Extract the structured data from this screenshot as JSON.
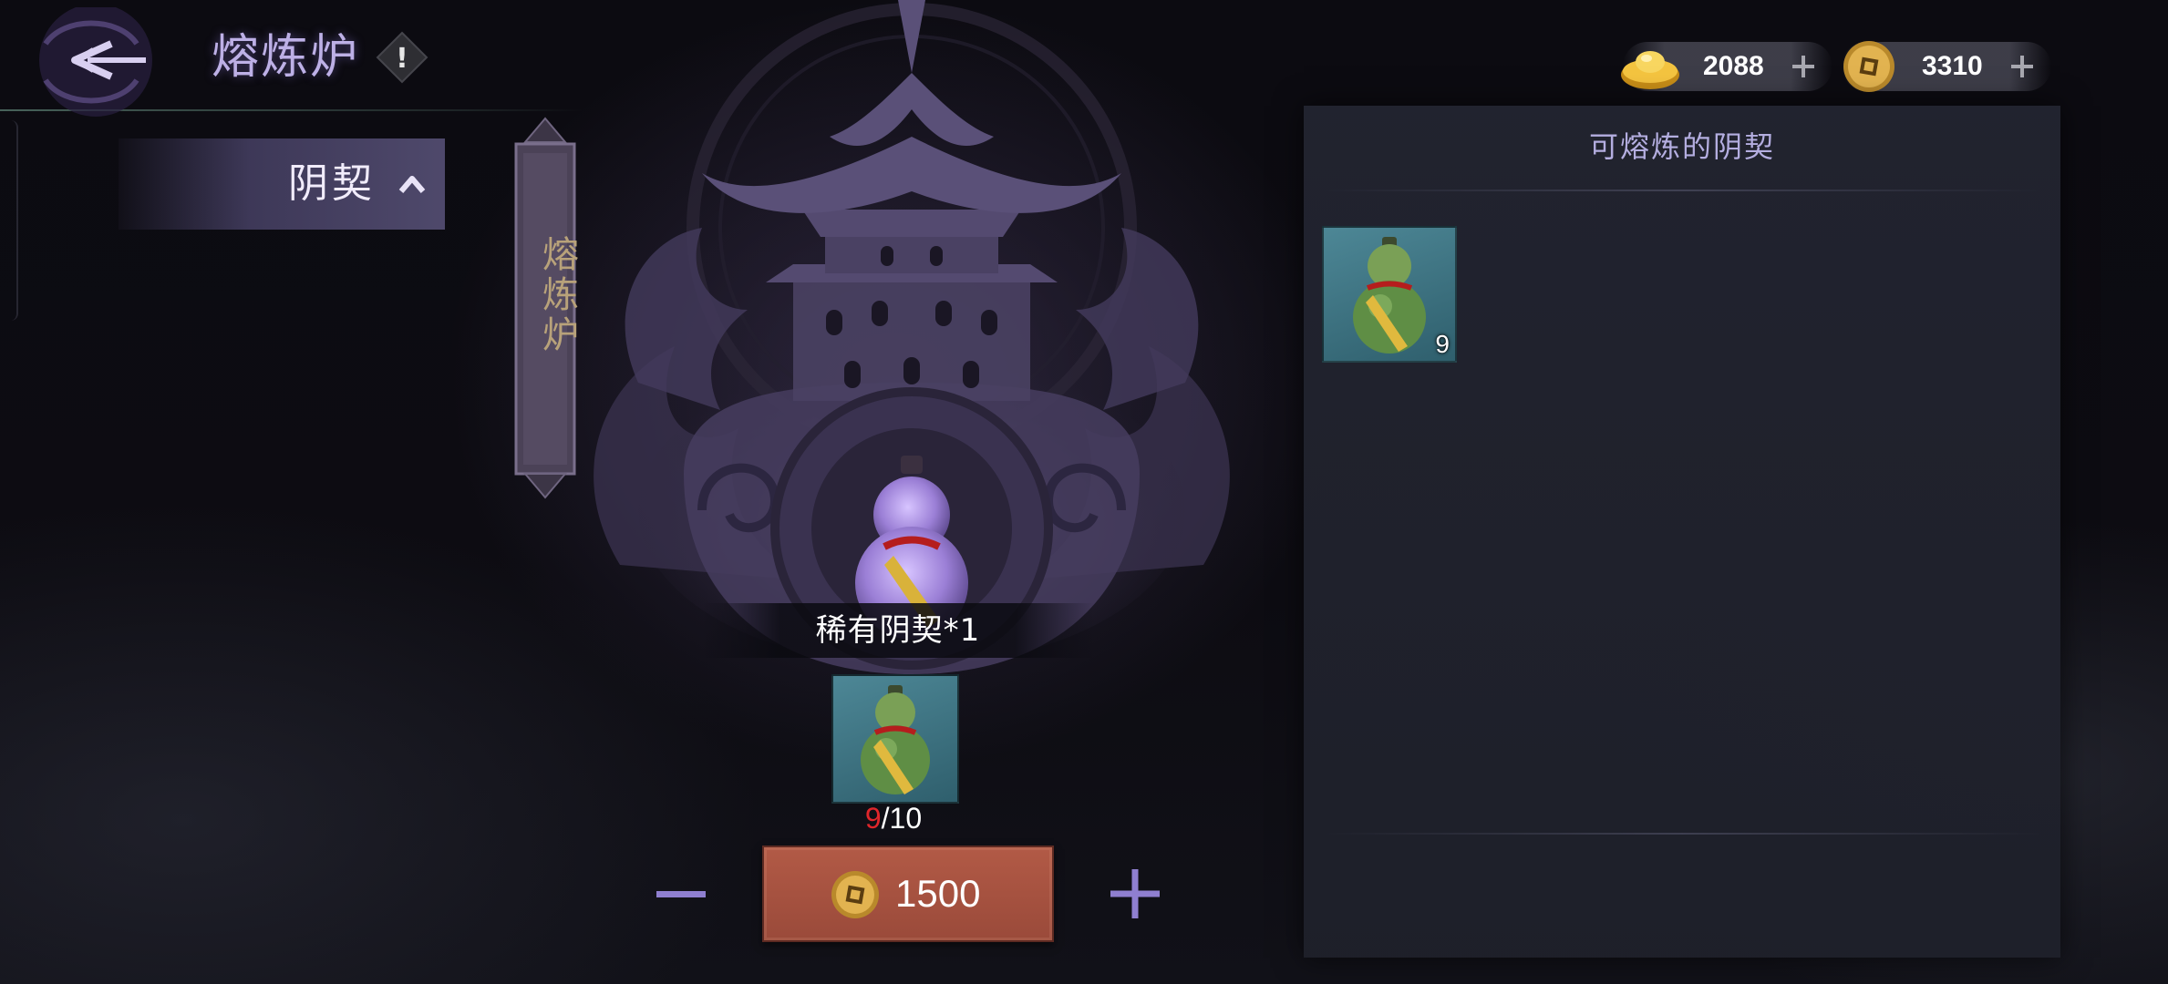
{
  "header": {
    "title": "熔炼炉",
    "info_glyph": "!"
  },
  "currency": {
    "gold_ingot": {
      "value": "2088",
      "icon": "gold-ingot-icon"
    },
    "coin": {
      "value": "3310",
      "icon": "copper-coin-icon"
    }
  },
  "sidebar": {
    "category_label": "阴契"
  },
  "scroll_label": "熔炼炉",
  "furnace": {
    "result_label": "稀有阴契*1",
    "material_have": "9",
    "material_need": "/10",
    "smelt_cost": "1500"
  },
  "right_panel": {
    "title": "可熔炼的阴契",
    "items": [
      {
        "count": "9",
        "icon": "green-gourd-icon"
      }
    ]
  },
  "colors": {
    "accent_purple": "#bdb0e6",
    "smelt_button": "#b25a46",
    "insufficient_red": "#e0262b",
    "scroll_text": "#b8a27a"
  }
}
